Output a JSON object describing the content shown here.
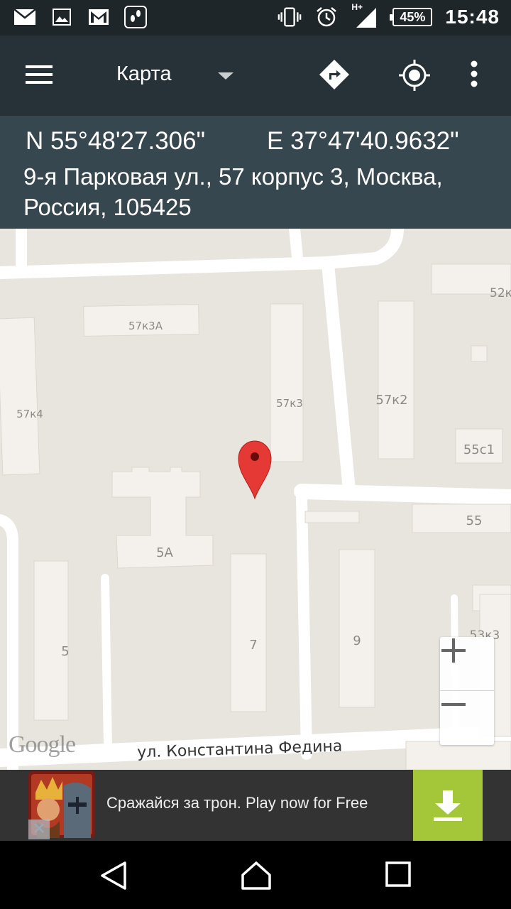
{
  "status_bar": {
    "battery": "45%",
    "time": "15:48",
    "network": "H+",
    "icons_left": [
      "mail-icon",
      "image-icon",
      "gmail-icon",
      "footsteps-icon"
    ],
    "icons_right": [
      "vibrate-icon",
      "alarm-icon",
      "signal-icon",
      "battery-icon"
    ]
  },
  "app_bar": {
    "title": "Карта",
    "icons": [
      "menu-icon",
      "dropdown-arrow-icon",
      "directions-icon",
      "my-location-icon",
      "more-vert-icon"
    ]
  },
  "location": {
    "lat": "N 55°48'27.306\"",
    "lon": "E 37°47'40.9632\"",
    "address": "9-я Парковая ул., 57 корпус 3, Москва, Россия, 105425"
  },
  "map": {
    "building_labels": [
      "57к3А",
      "57к4",
      "57к3",
      "57к2",
      "52к",
      "55с1",
      "55",
      "5А",
      "5",
      "7",
      "9",
      "53к3"
    ],
    "street_label": "ул. Константина Федина",
    "attribution": "Google",
    "zoom_in": "+",
    "zoom_out": "−",
    "marker_color": "#e53935"
  },
  "ad": {
    "text": "Сражайся за трон. Play now for Free",
    "accent": "#a4c639"
  },
  "colors": {
    "app_bar": "#263238",
    "info_panel": "#37474f",
    "map_bg": "#e8e4de",
    "building": "#f4f1ec"
  }
}
